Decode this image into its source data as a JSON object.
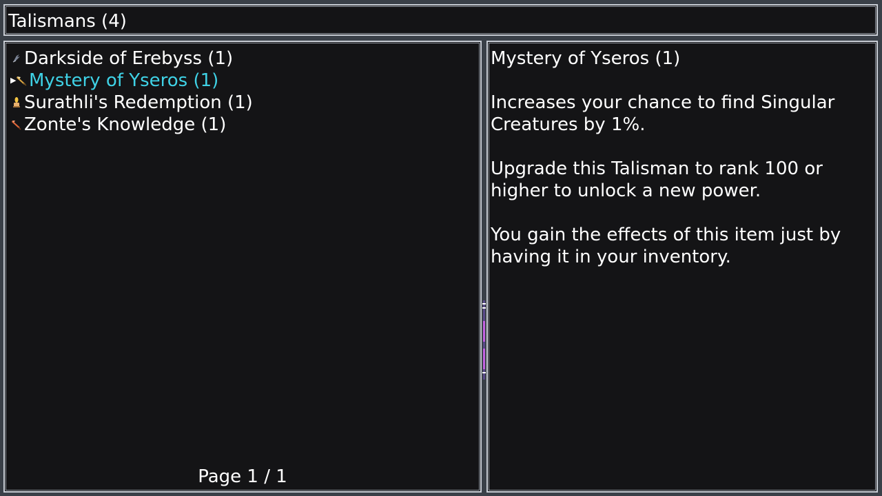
{
  "window": {
    "title": "Talismans (4)"
  },
  "list": {
    "items": [
      {
        "label": "Darkside of Erebyss (1)",
        "icon": "dark-claw-icon",
        "color": "#ffffff",
        "selected": false
      },
      {
        "label": "Mystery of Yseros (1)",
        "icon": "feather-quill-icon",
        "color": "#3fd2e6",
        "selected": true
      },
      {
        "label": "Surathli's Redemption (1)",
        "icon": "candle-flame-icon",
        "color": "#ffffff",
        "selected": false
      },
      {
        "label": "Zonte's Knowledge (1)",
        "icon": "orange-quill-icon",
        "color": "#ffffff",
        "selected": false
      }
    ],
    "pagination": "Page 1 / 1"
  },
  "detail": {
    "title": "Mystery of Yseros (1)",
    "paragraphs": [
      "Increases your chance to find Singular Creatures by 1%.",
      "Upgrade this Talisman to rank 100 or higher to unlock a new power.",
      "You gain the effects of this item just by having it in your inventory."
    ]
  },
  "colors": {
    "panel_bg": "#141416",
    "border": "#c9ced6",
    "text": "#ffffff",
    "selected_text": "#3fd2e6"
  }
}
